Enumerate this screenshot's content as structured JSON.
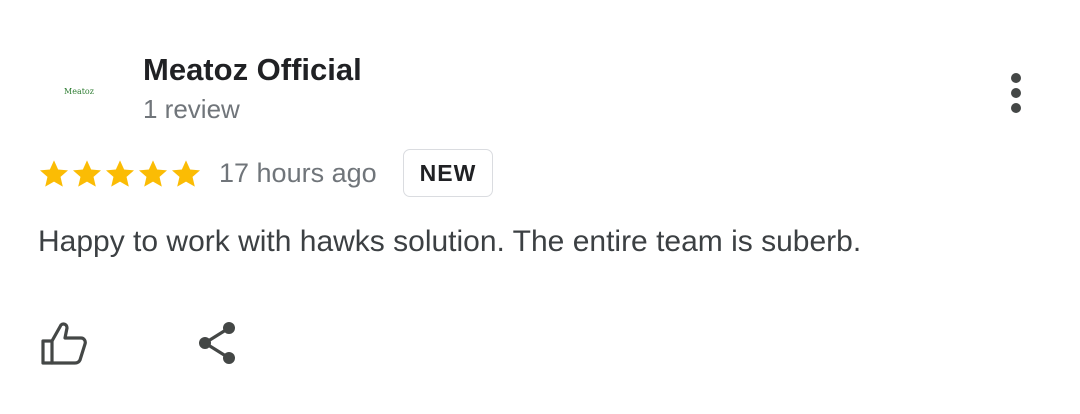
{
  "reviewer": {
    "avatar_text": "Meatoz",
    "name": "Meatoz Official",
    "review_count": "1 review"
  },
  "review": {
    "rating": 5,
    "rating_max": 5,
    "time_ago": "17 hours ago",
    "badge": "NEW",
    "text": "Happy to work with hawks solution. The entire team is suberb."
  },
  "icons": {
    "more": "more-vert-icon",
    "like": "thumb-up-icon",
    "share": "share-icon",
    "star": "star-icon"
  },
  "colors": {
    "star": "#FBBC04",
    "icon": "#444746",
    "secondary_text": "#70757a"
  }
}
